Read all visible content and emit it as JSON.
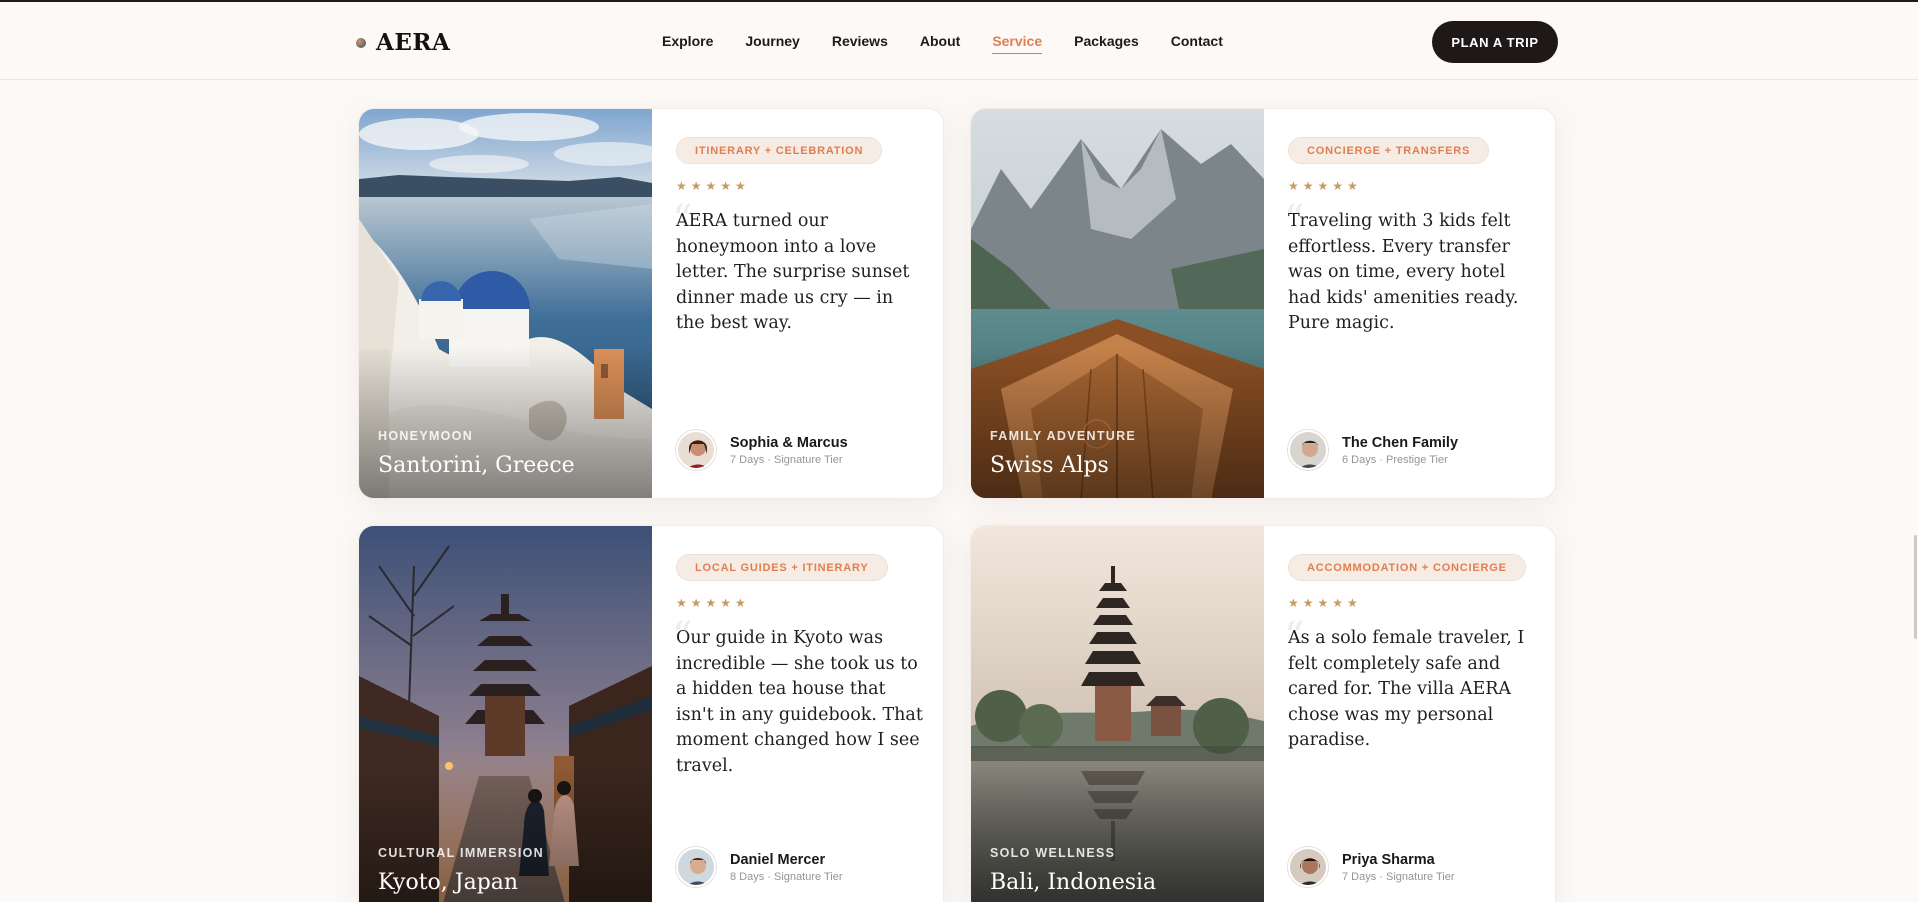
{
  "brand": {
    "name": "AERA"
  },
  "nav": {
    "items": [
      {
        "label": "Explore"
      },
      {
        "label": "Journey"
      },
      {
        "label": "Reviews"
      },
      {
        "label": "About"
      },
      {
        "label": "Service",
        "active": true
      },
      {
        "label": "Packages"
      },
      {
        "label": "Contact"
      }
    ],
    "cta_label": "PLAN A TRIP"
  },
  "colors": {
    "accent": "#e07e52",
    "dark": "#1e1818",
    "stars": "#c89a62",
    "tag_bg": "#f7ece4"
  },
  "testimonials": [
    {
      "category": "HONEYMOON",
      "place": "Santorini, Greece",
      "tag": "ITINERARY + CELEBRATION",
      "stars": "★★★★★",
      "quote": "AERA turned our honeymoon into a love letter. The surprise sunset dinner made us cry — in the best way.",
      "author": "Sophia & Marcus",
      "meta": "7 Days · Signature Tier"
    },
    {
      "category": "FAMILY ADVENTURE",
      "place": "Swiss Alps",
      "tag": "CONCIERGE + TRANSFERS",
      "stars": "★★★★★",
      "quote": "Traveling with 3 kids felt effortless. Every transfer was on time, every hotel had kids' amenities ready. Pure magic.",
      "author": "The Chen Family",
      "meta": "6 Days · Prestige Tier"
    },
    {
      "category": "CULTURAL IMMERSION",
      "place": "Kyoto, Japan",
      "tag": "LOCAL GUIDES + ITINERARY",
      "stars": "★★★★★",
      "quote": "Our guide in Kyoto was incredible — she took us to a hidden tea house that isn't in any guidebook. That moment changed how I see travel.",
      "author": "Daniel Mercer",
      "meta": "8 Days · Signature Tier"
    },
    {
      "category": "SOLO WELLNESS",
      "place": "Bali, Indonesia",
      "tag": "ACCOMMODATION + CONCIERGE",
      "stars": "★★★★★",
      "quote": "As a solo female traveler, I felt completely safe and cared for. The villa AERA chose was my personal paradise.",
      "author": "Priya Sharma",
      "meta": "7 Days · Signature Tier"
    }
  ]
}
